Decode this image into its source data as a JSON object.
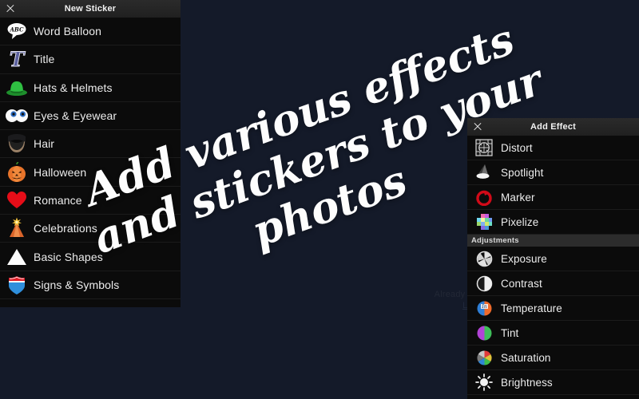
{
  "background": {
    "color": "#141a29",
    "promo_text": "Already a member ?",
    "promo_login": "Log In"
  },
  "headline": {
    "line1": "Add various effects",
    "line2": "and stickers to your",
    "line3": "photos",
    "full": "Add various effects and stickers to your photos"
  },
  "sticker_panel": {
    "title": "New Sticker",
    "close_icon": "close-icon",
    "items": [
      {
        "label": "Word Balloon",
        "icon": "word-balloon-icon"
      },
      {
        "label": "Title",
        "icon": "title-letter-t-icon"
      },
      {
        "label": "Hats & Helmets",
        "icon": "green-bowler-hat-icon"
      },
      {
        "label": "Eyes & Eyewear",
        "icon": "googly-eyes-icon"
      },
      {
        "label": "Hair",
        "icon": "hair-beard-icon"
      },
      {
        "label": "Halloween",
        "icon": "pumpkin-icon"
      },
      {
        "label": "Romance",
        "icon": "red-heart-icon"
      },
      {
        "label": "Celebrations",
        "icon": "party-hat-icon"
      },
      {
        "label": "Basic Shapes",
        "icon": "white-triangle-icon"
      },
      {
        "label": "Signs & Symbols",
        "icon": "highway-shield-icon"
      }
    ]
  },
  "effect_panel": {
    "title": "Add Effect",
    "close_icon": "close-icon",
    "effects": [
      {
        "label": "Distort",
        "icon": "distort-mesh-icon"
      },
      {
        "label": "Spotlight",
        "icon": "spotlight-cone-icon"
      },
      {
        "label": "Marker",
        "icon": "marker-pen-icon"
      },
      {
        "label": "Pixelize",
        "icon": "pixelize-icon"
      }
    ],
    "section_label": "Adjustments",
    "adjustments": [
      {
        "label": "Exposure",
        "icon": "aperture-icon"
      },
      {
        "label": "Contrast",
        "icon": "contrast-half-circle-icon"
      },
      {
        "label": "Temperature",
        "icon": "temperature-circle-icon"
      },
      {
        "label": "Tint",
        "icon": "tint-circle-icon"
      },
      {
        "label": "Saturation",
        "icon": "saturation-wheel-icon"
      },
      {
        "label": "Brightness",
        "icon": "brightness-sun-icon"
      }
    ]
  },
  "colors": {
    "canvas": "#141a29",
    "panel": "#0b0b0b",
    "header": "#262626",
    "text": "#ececec",
    "accent_red": "#d9152a",
    "accent_green": "#22a236",
    "accent_blue": "#2f7fd6"
  }
}
